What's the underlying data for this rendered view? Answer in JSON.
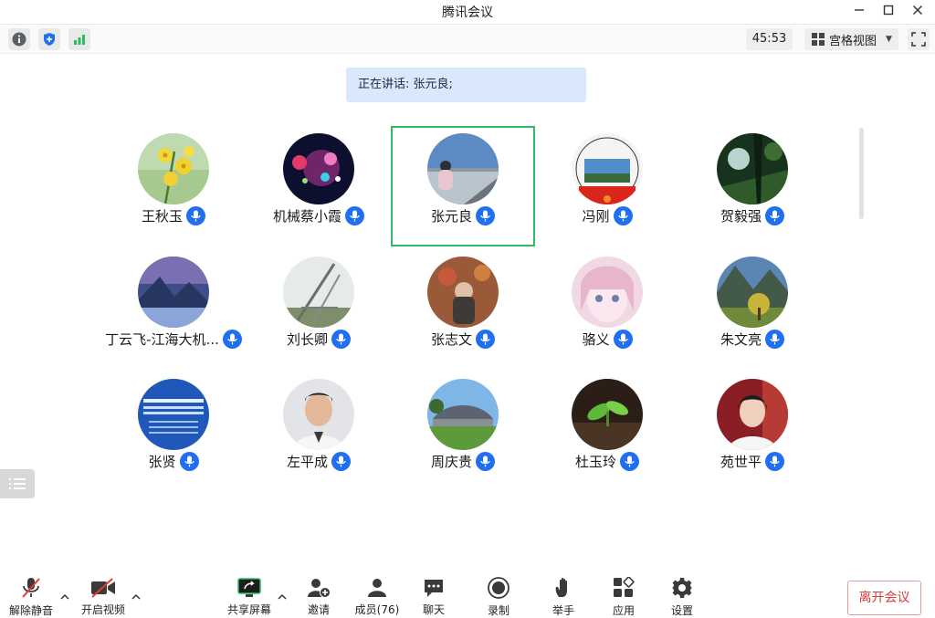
{
  "window": {
    "title": "腾讯会议"
  },
  "infobar": {
    "timer": "45:53",
    "view_label": "宫格视图"
  },
  "speaking": {
    "text": "正在讲话: 张元良;"
  },
  "participants": [
    {
      "name": "王秋玉"
    },
    {
      "name": "机械蔡小霞"
    },
    {
      "name": "张元良"
    },
    {
      "name": "冯刚"
    },
    {
      "name": "贺毅强"
    },
    {
      "name": "丁云飞-江海大机..."
    },
    {
      "name": "刘长卿"
    },
    {
      "name": "张志文"
    },
    {
      "name": "骆义"
    },
    {
      "name": "朱文亮"
    },
    {
      "name": "张贤"
    },
    {
      "name": "左平成"
    },
    {
      "name": "周庆贵"
    },
    {
      "name": "杜玉玲"
    },
    {
      "name": "苑世平"
    }
  ],
  "toolbar": {
    "unmute": "解除静音",
    "start_video": "开启视频",
    "share_screen": "共享屏幕",
    "invite": "邀请",
    "members": "成员(76)",
    "chat": "聊天",
    "record": "录制",
    "raise_hand": "举手",
    "apps": "应用",
    "settings": "设置",
    "leave": "离开会议"
  },
  "colors": {
    "active_border": "#2bbd5f",
    "mic_badge": "#1f6ff0",
    "banner_bg": "#d9e8fb",
    "leave": "#d83c3c"
  }
}
